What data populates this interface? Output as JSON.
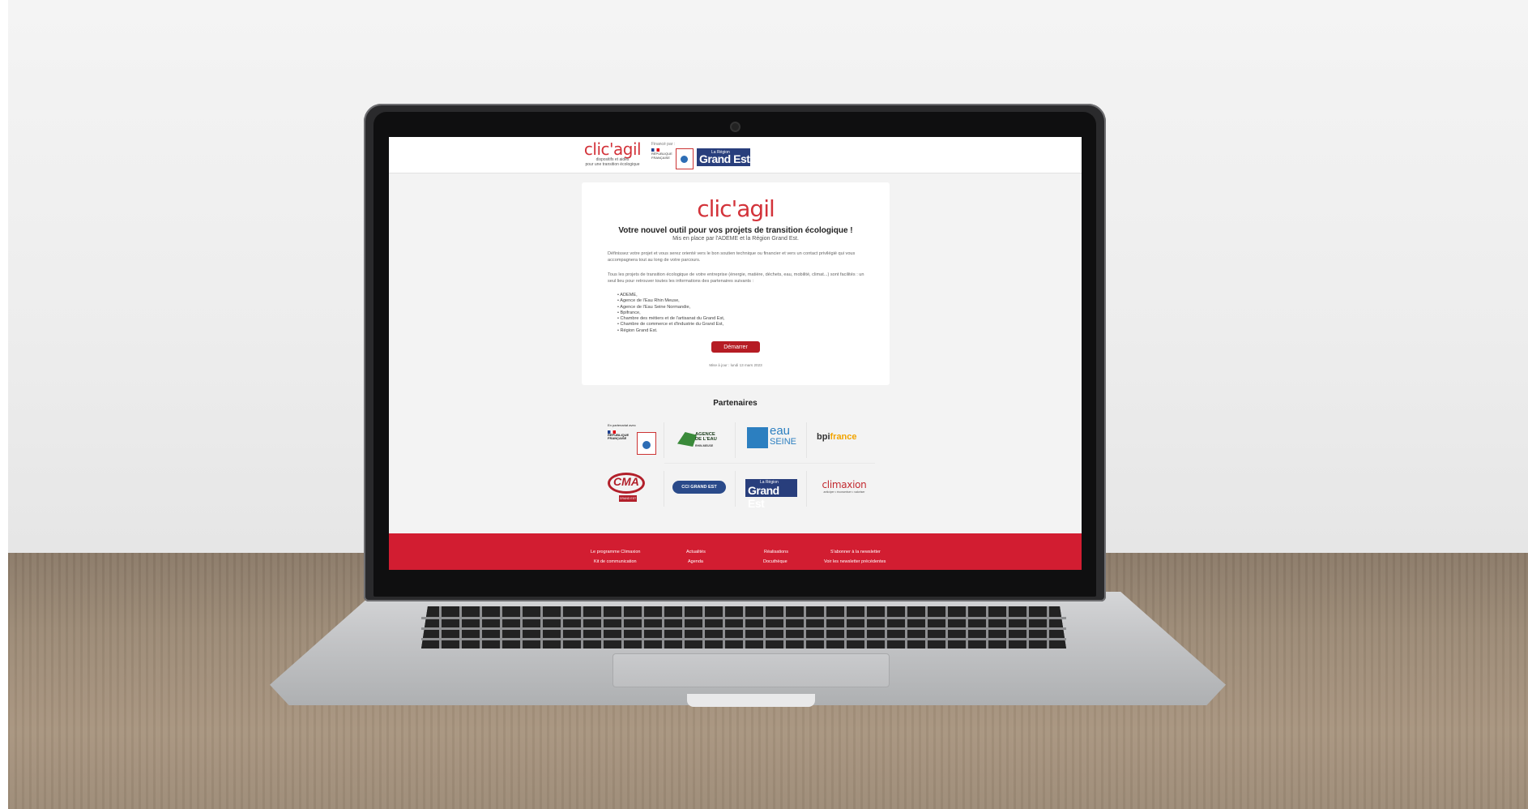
{
  "header": {
    "logo_word": "clic'agil",
    "logo_tagline_1": "dispositifs et aides",
    "logo_tagline_2": "pour une transition écologique",
    "financed_by": "Financé par :",
    "rf_label": "RÉPUBLIQUE FRANÇAISE",
    "region_small": "La Région",
    "region_big": "Grand Est"
  },
  "card": {
    "logo_word": "clic'agil",
    "title": "Votre nouvel outil pour vos projets de transition écologique !",
    "subtitle": "Mis en place par l'ADEME et la Région Grand Est.",
    "para1": "Définissez votre projet et vous serez orienté vers le bon soutien technique ou financier et vers un contact privilégié qui vous accompagnera tout au long de votre parcours.",
    "para2": "Tous les projets de transition écologique de votre entreprise (énergie, matière, déchets, eau, mobilité, climat...) sont facilités : un seul lieu pour retrouver toutes les informations des partenaires suivants :",
    "partners_list": [
      "ADEME,",
      "Agence de l'Eau Rhin Meuse,",
      "Agence de l'Eau Seine Normandie,",
      "Bpifrance,",
      "Chambre des métiers et de l'artisanat du Grand Est,",
      "Chambre de commerce et d'industrie du Grand Est,",
      "Région Grand Est."
    ],
    "start_button": "Démarrer",
    "updated": "Mise à jour : lundi 13 mars 2023"
  },
  "partners": {
    "title": "Partenaires",
    "eu_caption": "En partenariat avec",
    "eu_rf": "RÉPUBLIQUE FRANÇAISE",
    "rhin_meuse": "AGENCE DE L'EAU",
    "rhin_meuse_sub": "RHIN-MEUSE",
    "seine_word": "eau",
    "seine_sub": "SEINE",
    "bpi_a": "bpi",
    "bpi_b": "france",
    "cma": "CMA",
    "cma_tag": "GRAND EST",
    "cci": "CCI GRAND EST",
    "ge_small": "La Région",
    "ge_big": "Grand Est",
    "climaxion": "climaxion",
    "climaxion_tag": "anticiper • économiser • valoriser"
  },
  "footer": {
    "col1": [
      "Le programme Climaxion",
      "Kit de communication"
    ],
    "col2": [
      "Actualités",
      "Agenda"
    ],
    "col3": [
      "Réalisations",
      "Docuthèque"
    ],
    "col4": [
      "S'abonner à la newsletter",
      "Voir les newsletter précédentes"
    ]
  },
  "colors": {
    "brand_red": "#d3333a",
    "button_red": "#b61c24",
    "footer_red": "#d21d31",
    "grand_est_blue": "#283e7c"
  }
}
